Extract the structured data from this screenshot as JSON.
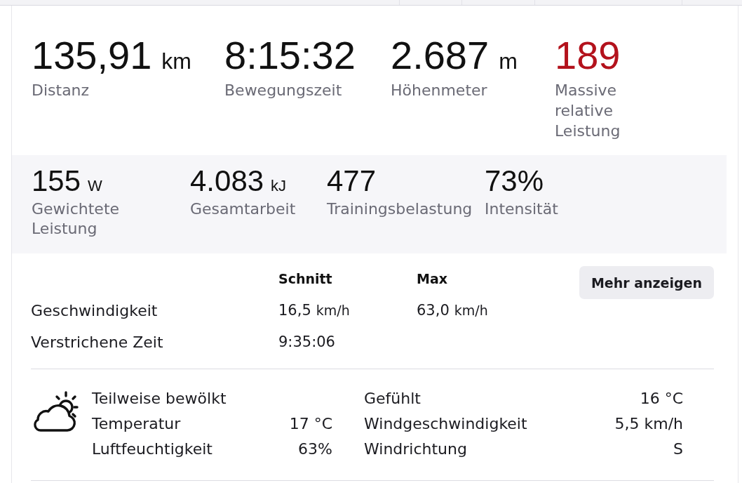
{
  "primary_stats": [
    {
      "value": "135,91",
      "unit": "km",
      "label": "Distanz",
      "color": "#111111"
    },
    {
      "value": "8:15:32",
      "label": "Bewegungszeit",
      "color": "#111111"
    },
    {
      "value": "2.687",
      "unit": "m",
      "label": "Höhenmeter",
      "color": "#111111"
    },
    {
      "value": "189",
      "label": "Massive relative Leistung",
      "color": "#b3121c"
    }
  ],
  "secondary_stats": [
    {
      "value": "155",
      "unit": "W",
      "label": "Gewichtete Leistung"
    },
    {
      "value": "4.083",
      "unit": "kJ",
      "label": "Gesamtarbeit"
    },
    {
      "value": "477",
      "label": "Trainingsbelastung"
    },
    {
      "value": "73%",
      "label": "Intensität"
    }
  ],
  "details_table": {
    "columns": [
      "Schnitt",
      "Max"
    ],
    "rows": [
      {
        "label": "Geschwindigkeit",
        "cells": [
          {
            "value": "16,5",
            "unit": "km/h"
          },
          {
            "value": "63,0",
            "unit": "km/h"
          }
        ]
      },
      {
        "label": "Verstrichene Zeit",
        "cells": [
          {
            "value": "9:35:06"
          }
        ]
      }
    ]
  },
  "more_button": {
    "label": "Mehr anzeigen"
  },
  "weather": {
    "condition": "Teilweise bewölkt",
    "left": [
      {
        "label": "Temperatur",
        "value": "17 °C"
      },
      {
        "label": "Luftfeuchtigkeit",
        "value": "63%"
      }
    ],
    "right": [
      {
        "label": "Gefühlt",
        "value": "16 °C"
      },
      {
        "label": "Windgeschwindigkeit",
        "value": "5,5 km/h"
      },
      {
        "label": "Windrichtung",
        "value": "S"
      }
    ]
  }
}
